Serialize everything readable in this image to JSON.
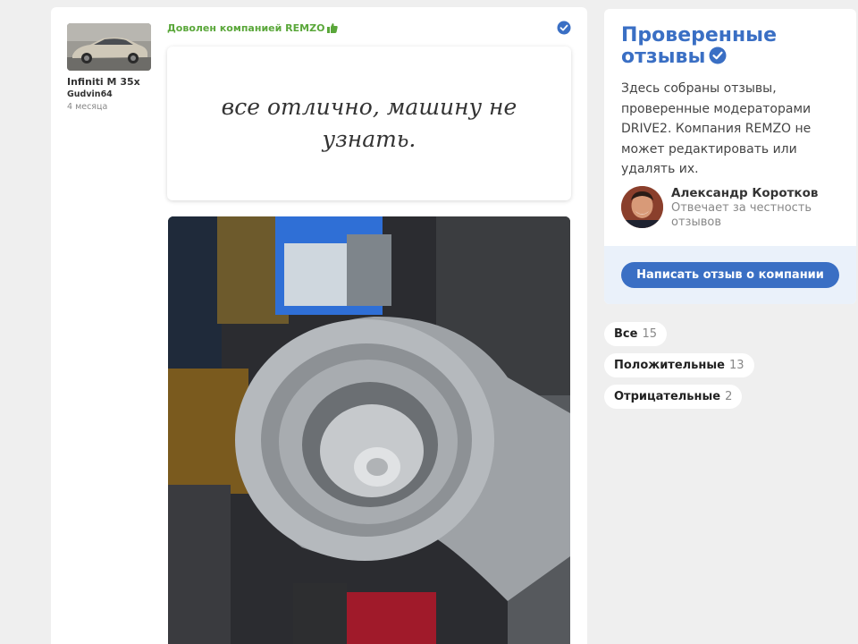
{
  "review": {
    "car": "Infiniti M 35x",
    "user": "Gudvin64",
    "date": "4 месяца",
    "verdict": "Доволен компанией REMZO",
    "text": "все отлично, машину не узнать."
  },
  "sidebar": {
    "title": "Проверенные отзывы",
    "description": "Здесь собраны отзывы, проверенные модераторами DRIVE2. Компания REMZO не может редактировать или удалять их.",
    "person_name": "Александр Коротков",
    "person_role": "Отвечает за честность отзывов",
    "write_button": "Написать отзыв о компании"
  },
  "filters": [
    {
      "label": "Все",
      "count": "15"
    },
    {
      "label": "Положительные",
      "count": "13"
    },
    {
      "label": "Отрицательные",
      "count": "2"
    }
  ],
  "colors": {
    "accent": "#3a6fc4",
    "positive": "#5aa73a"
  }
}
